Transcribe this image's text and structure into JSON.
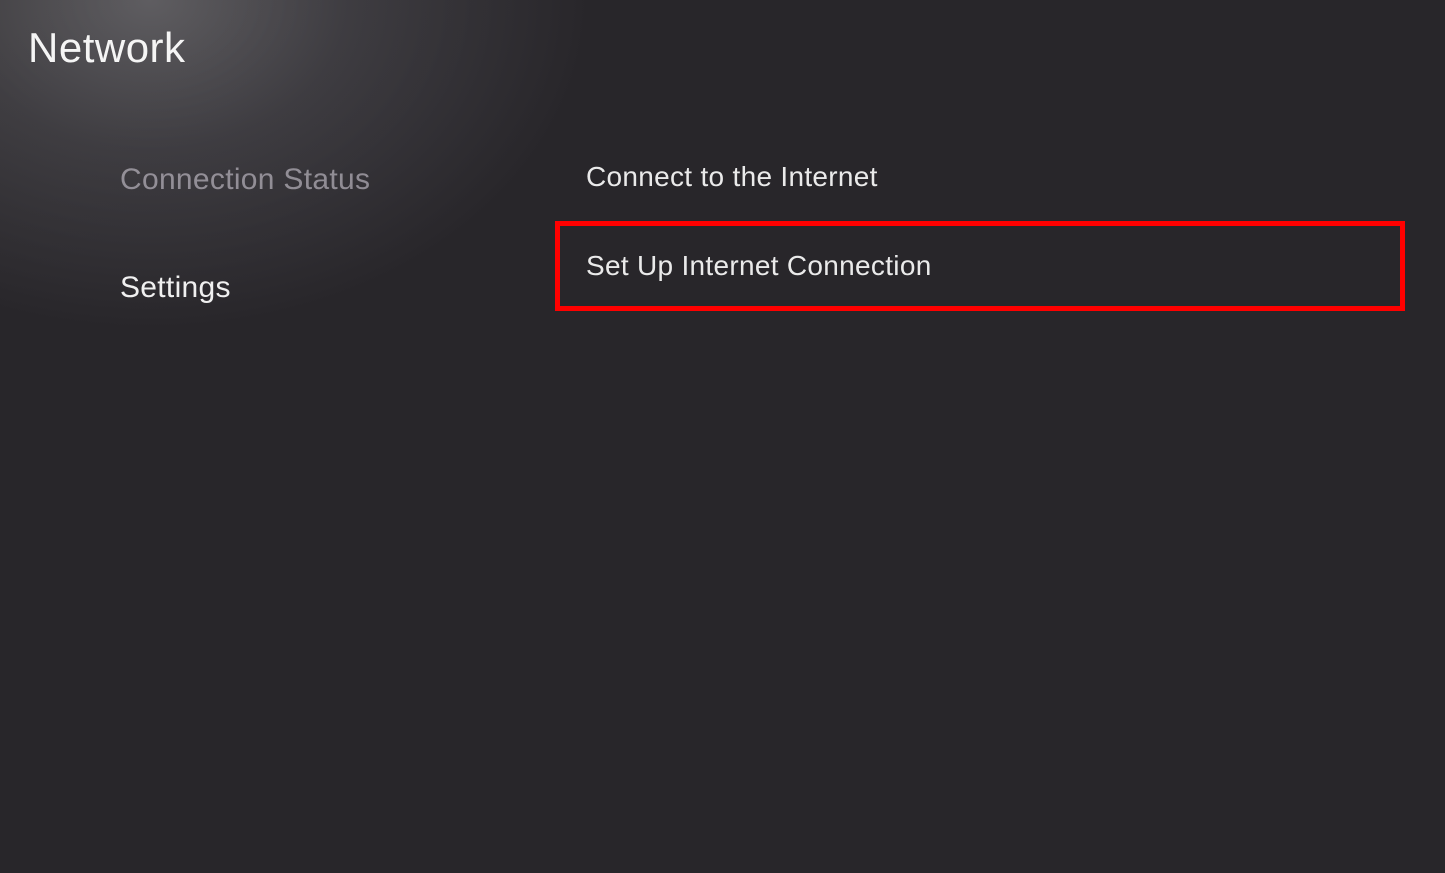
{
  "header": {
    "title": "Network"
  },
  "sidebar": {
    "items": [
      {
        "label": "Connection Status",
        "active": false
      },
      {
        "label": "Settings",
        "active": true
      }
    ]
  },
  "main": {
    "items": [
      {
        "label": "Connect to the Internet",
        "highlighted": false
      },
      {
        "label": "Set Up Internet Connection",
        "highlighted": true
      }
    ]
  }
}
